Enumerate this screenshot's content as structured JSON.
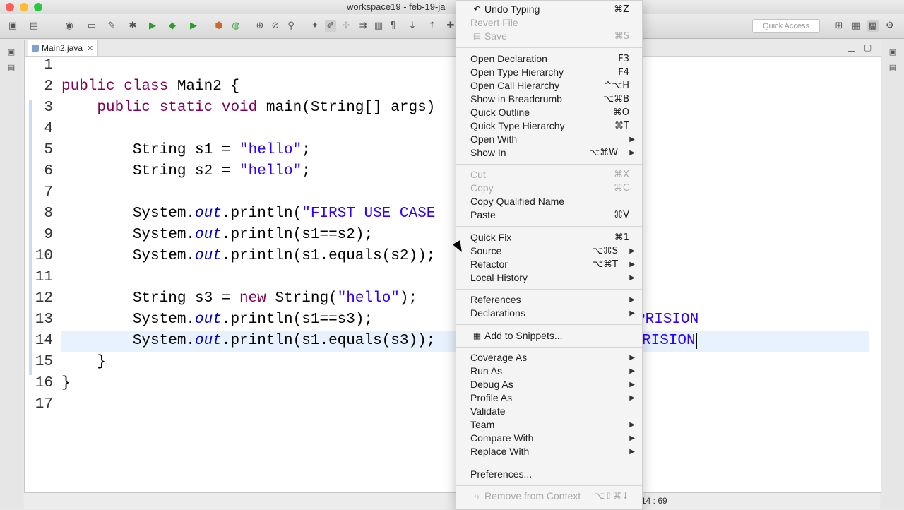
{
  "window": {
    "title": "workspace19 - feb-19-ja"
  },
  "toolbar": {
    "quick_access_placeholder": "Quick Access"
  },
  "editor": {
    "tab_label": "Main2.java",
    "status_position": "14 : 69",
    "lines": [
      {
        "n": "1",
        "segments": []
      },
      {
        "n": "2",
        "segments": [
          {
            "t": "public class ",
            "c": "kw"
          },
          {
            "t": "Main2 {",
            "c": ""
          }
        ]
      },
      {
        "n": "3",
        "segments": [
          {
            "t": "    public static void ",
            "c": "kw"
          },
          {
            "t": "main(String[] args) ",
            "c": ""
          }
        ]
      },
      {
        "n": "4",
        "segments": []
      },
      {
        "n": "5",
        "segments": [
          {
            "t": "        String s1 = ",
            "c": ""
          },
          {
            "t": "\"hello\"",
            "c": "str"
          },
          {
            "t": ";",
            "c": ""
          }
        ]
      },
      {
        "n": "6",
        "segments": [
          {
            "t": "        String s2 = ",
            "c": ""
          },
          {
            "t": "\"hello\"",
            "c": "str"
          },
          {
            "t": ";",
            "c": ""
          }
        ]
      },
      {
        "n": "7",
        "segments": []
      },
      {
        "n": "8",
        "segments": [
          {
            "t": "        System.",
            "c": ""
          },
          {
            "t": "out",
            "c": "fld"
          },
          {
            "t": ".println(",
            "c": ""
          },
          {
            "t": "\"FIRST USE CASE",
            "c": "str"
          }
        ]
      },
      {
        "n": "9",
        "segments": [
          {
            "t": "        System.",
            "c": ""
          },
          {
            "t": "out",
            "c": "fld"
          },
          {
            "t": ".println(s1==s2);",
            "c": ""
          }
        ]
      },
      {
        "n": "10",
        "segments": [
          {
            "t": "        System.",
            "c": ""
          },
          {
            "t": "out",
            "c": "fld"
          },
          {
            "t": ".println(s1.equals(s2));",
            "c": ""
          }
        ]
      },
      {
        "n": "11",
        "segments": []
      },
      {
        "n": "12",
        "segments": [
          {
            "t": "        String s3 = ",
            "c": ""
          },
          {
            "t": "new ",
            "c": "kw"
          },
          {
            "t": "String(",
            "c": ""
          },
          {
            "t": "\"hello\"",
            "c": "str"
          },
          {
            "t": ");",
            "c": ""
          }
        ]
      },
      {
        "n": "13",
        "segments": [
          {
            "t": "        System.",
            "c": ""
          },
          {
            "t": "out",
            "c": "fld"
          },
          {
            "t": ".println(s1==s3);",
            "c": ""
          }
        ]
      },
      {
        "n": "14",
        "segments": [
          {
            "t": "        System.",
            "c": ""
          },
          {
            "t": "out",
            "c": "fld"
          },
          {
            "t": ".println(s1.equals(s3));",
            "c": ""
          }
        ]
      },
      {
        "n": "15",
        "segments": [
          {
            "t": "    }",
            "c": ""
          }
        ]
      },
      {
        "n": "16",
        "segments": [
          {
            "t": "}",
            "c": ""
          }
        ]
      },
      {
        "n": "17",
        "segments": []
      }
    ],
    "overflow_text_13": "PRISION",
    "overflow_text_14": "RISION"
  },
  "context_menu": {
    "items": [
      {
        "label": "Undo Typing",
        "shortcut": "⌘Z",
        "disabled": false,
        "icon": "undo-icon",
        "submenu": false
      },
      {
        "label": "Revert File",
        "shortcut": "",
        "disabled": true,
        "submenu": false
      },
      {
        "label": "Save",
        "shortcut": "⌘S",
        "disabled": true,
        "icon": "save-icon",
        "submenu": false
      },
      {
        "label": "Open Declaration",
        "shortcut": "F3",
        "disabled": false,
        "submenu": false
      },
      {
        "label": "Open Type Hierarchy",
        "shortcut": "F4",
        "disabled": false,
        "submenu": false
      },
      {
        "label": "Open Call Hierarchy",
        "shortcut": "^⌥H",
        "disabled": false,
        "submenu": false
      },
      {
        "label": "Show in Breadcrumb",
        "shortcut": "⌥⌘B",
        "disabled": false,
        "submenu": false
      },
      {
        "label": "Quick Outline",
        "shortcut": "⌘O",
        "disabled": false,
        "submenu": false
      },
      {
        "label": "Quick Type Hierarchy",
        "shortcut": "⌘T",
        "disabled": false,
        "submenu": false
      },
      {
        "label": "Open With",
        "shortcut": "",
        "disabled": false,
        "submenu": true
      },
      {
        "label": "Show In",
        "shortcut": "⌥⌘W",
        "disabled": false,
        "submenu": true
      },
      {
        "label": "Cut",
        "shortcut": "⌘X",
        "disabled": true,
        "submenu": false
      },
      {
        "label": "Copy",
        "shortcut": "⌘C",
        "disabled": true,
        "submenu": false
      },
      {
        "label": "Copy Qualified Name",
        "shortcut": "",
        "disabled": false,
        "submenu": false
      },
      {
        "label": "Paste",
        "shortcut": "⌘V",
        "disabled": false,
        "submenu": false
      },
      {
        "label": "Quick Fix",
        "shortcut": "⌘1",
        "disabled": false,
        "submenu": false
      },
      {
        "label": "Source",
        "shortcut": "⌥⌘S",
        "disabled": false,
        "submenu": true
      },
      {
        "label": "Refactor",
        "shortcut": "⌥⌘T",
        "disabled": false,
        "submenu": true
      },
      {
        "label": "Local History",
        "shortcut": "",
        "disabled": false,
        "submenu": true
      },
      {
        "label": "References",
        "shortcut": "",
        "disabled": false,
        "submenu": true
      },
      {
        "label": "Declarations",
        "shortcut": "",
        "disabled": false,
        "submenu": true
      },
      {
        "label": "Add to Snippets...",
        "shortcut": "",
        "disabled": false,
        "icon": "snippets-icon",
        "submenu": false
      },
      {
        "label": "Coverage As",
        "shortcut": "",
        "disabled": false,
        "submenu": true
      },
      {
        "label": "Run As",
        "shortcut": "",
        "disabled": false,
        "submenu": true
      },
      {
        "label": "Debug As",
        "shortcut": "",
        "disabled": false,
        "submenu": true
      },
      {
        "label": "Profile As",
        "shortcut": "",
        "disabled": false,
        "submenu": true
      },
      {
        "label": "Validate",
        "shortcut": "",
        "disabled": false,
        "submenu": false
      },
      {
        "label": "Team",
        "shortcut": "",
        "disabled": false,
        "submenu": true
      },
      {
        "label": "Compare With",
        "shortcut": "",
        "disabled": false,
        "submenu": true
      },
      {
        "label": "Replace With",
        "shortcut": "",
        "disabled": false,
        "submenu": true
      },
      {
        "label": "Preferences...",
        "shortcut": "",
        "disabled": false,
        "submenu": false
      },
      {
        "label": "Remove from Context",
        "shortcut": "⌥⇧⌘↓",
        "disabled": true,
        "icon": "context-icon",
        "submenu": false
      }
    ]
  },
  "colors": {
    "keyword": "#7f0055",
    "string": "#2a00ff",
    "field": "#0000c0",
    "current_line": "#e8f2fe"
  }
}
